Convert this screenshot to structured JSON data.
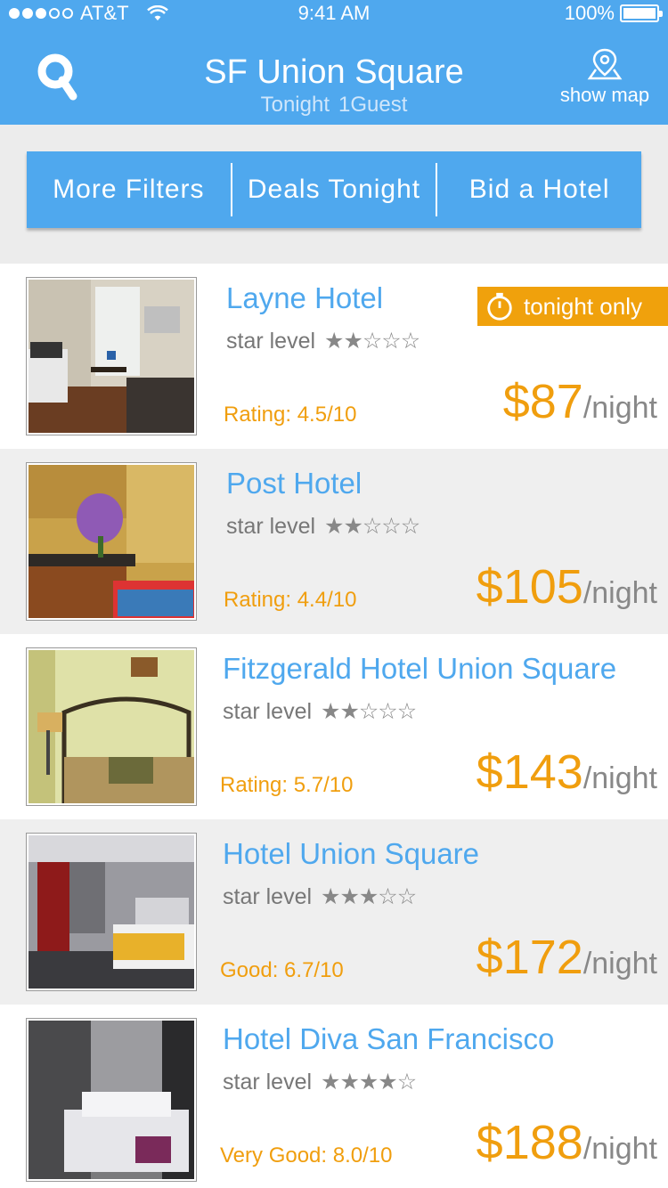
{
  "status": {
    "carrier": "AT&T",
    "time": "9:41 AM",
    "battery": "100%"
  },
  "header": {
    "title": "SF Union Square",
    "date": "Tonight",
    "guests": "1Guest",
    "map_label": "show map"
  },
  "filters": [
    "More Filters",
    "Deals Tonight",
    "Bid a Hotel"
  ],
  "star_label": "star level",
  "price_unit": "/night",
  "badge_label": "tonight only",
  "hotels": [
    {
      "name": "Layne Hotel",
      "stars": "★★☆☆☆",
      "stars_value": 2,
      "rating": "Rating: 4.5/10",
      "price": "$87",
      "badge": true
    },
    {
      "name": "Post Hotel",
      "stars": "★★☆☆☆",
      "stars_value": 2,
      "rating": "Rating: 4.4/10",
      "price": "$105",
      "badge": false
    },
    {
      "name": "Fitzgerald Hotel Union Square",
      "stars": "★★☆☆☆",
      "stars_value": 2,
      "rating": "Rating: 5.7/10",
      "price": "$143",
      "badge": false
    },
    {
      "name": "Hotel Union Square",
      "stars": "★★★☆☆",
      "stars_value": 3,
      "rating": "Good: 6.7/10",
      "price": "$172",
      "badge": false
    },
    {
      "name": "Hotel Diva San Francisco",
      "stars": "★★★★☆",
      "stars_value": 4,
      "rating": "Very Good: 8.0/10",
      "price": "$188",
      "badge": false
    }
  ],
  "colors": {
    "brand_blue": "#4fa8ee",
    "accent_orange": "#f09e0e",
    "row_alt": "#efefef"
  }
}
